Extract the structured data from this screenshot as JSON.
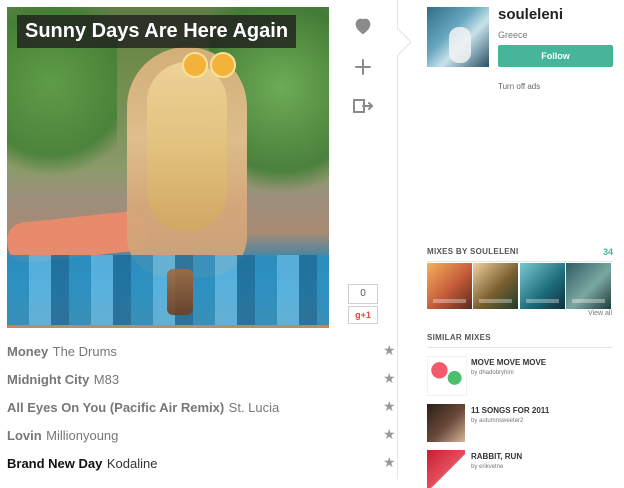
{
  "mix": {
    "title": "Sunny Days Are Here Again"
  },
  "actions": {
    "like_icon": "heart-icon",
    "add_icon": "plus-icon",
    "share_icon": "share-icon",
    "counter_value": "0",
    "gplus_label": "g+1"
  },
  "tracks": [
    {
      "title": "Money",
      "artist": "The Drums"
    },
    {
      "title": "Midnight City",
      "artist": "M83"
    },
    {
      "title": "All Eyes On You (Pacific Air Remix)",
      "artist": "St. Lucia"
    },
    {
      "title": "Lovin",
      "artist": "Millionyoung"
    },
    {
      "title": "Brand New Day",
      "artist": "Kodaline"
    }
  ],
  "profile": {
    "username": "souleleni",
    "country": "Greece",
    "follow_label": "Follow",
    "turn_off_ads": "Turn off ads"
  },
  "mixes_by": {
    "heading": "MIXES BY SOULELENI",
    "count": "34",
    "view_all": "View all"
  },
  "similar": {
    "heading": "SIMILAR MIXES",
    "items": [
      {
        "title": "MOVE MOVE MOVE",
        "by": "by dhadobryhim"
      },
      {
        "title": "11 SONGS FOR 2011",
        "by": "by autumnsweeter2"
      },
      {
        "title": "RABBIT, RUN",
        "by": "by erikvetne"
      }
    ]
  },
  "colors": {
    "accent": "#47b59a"
  }
}
